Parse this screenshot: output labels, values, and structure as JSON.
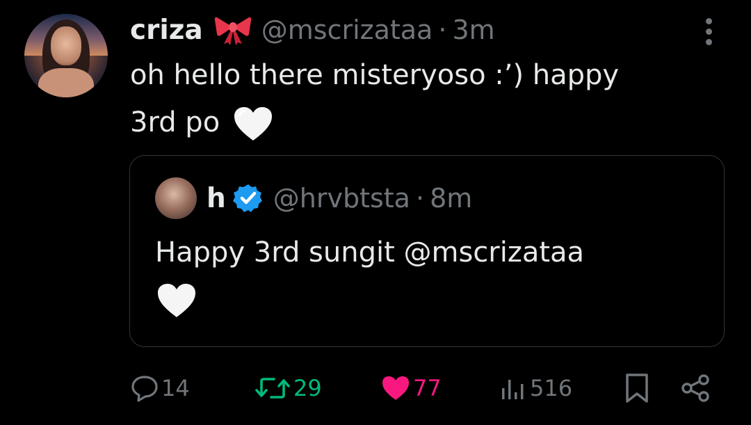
{
  "tweet": {
    "author": {
      "name": "criza",
      "emoji": "ribbon",
      "handle": "@mscrizataa",
      "separator": "·",
      "time": "3m"
    },
    "text_line1": "oh hello there misteryoso :’) happy",
    "text_line2": "3rd po",
    "text_emoji": "white-heart",
    "quote": {
      "author": {
        "name": "h",
        "verified": true,
        "handle": "@hrvbtsta",
        "separator": "·",
        "time": "8m"
      },
      "text": "Happy 3rd sungit @mscrizataa",
      "text_emoji": "white-heart"
    },
    "actions": {
      "replies": "14",
      "retweets": "29",
      "likes": "77",
      "views": "516"
    }
  },
  "colors": {
    "background": "#000000",
    "text": "#e7e9ea",
    "muted": "#71767b",
    "retweet": "#00ba7c",
    "like": "#f91880",
    "verified": "#1d9bf0",
    "border": "#333639"
  }
}
